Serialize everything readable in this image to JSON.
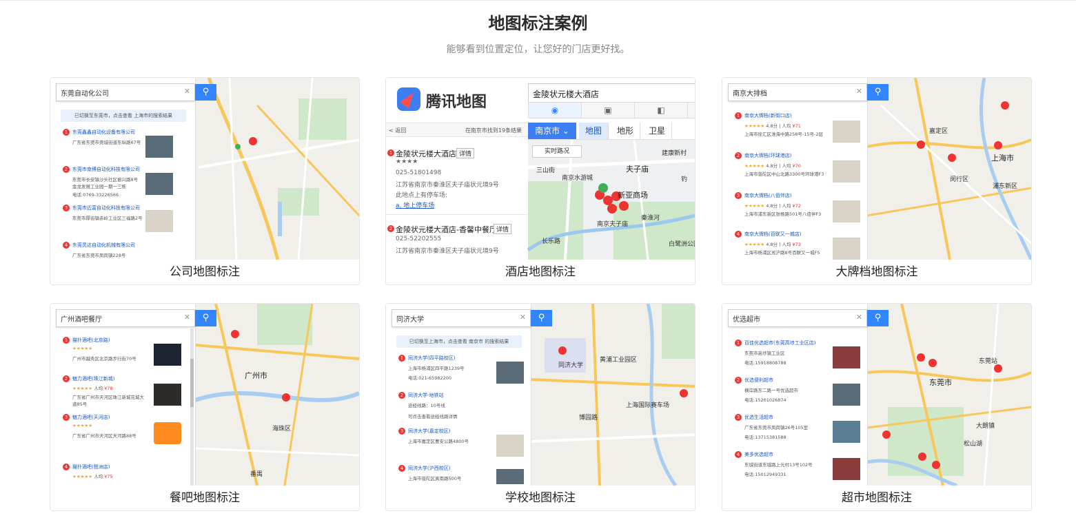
{
  "section": {
    "title": "地图标注案例",
    "subtitle": "能够看到位置定位，让您好的门店更好找。"
  },
  "cards": [
    {
      "caption": "公司地图标注",
      "search": "东莞自动化公司",
      "notice": "已切换至东莞市，点击查看 上海市的搜索结果",
      "results": [
        {
          "n": "1",
          "title": "东莞鑫鑫自动化设备有限公司",
          "line": "广东省东莞市莞城街道东纵路67号"
        },
        {
          "n": "2",
          "title": "东莞市南博自动化科技有限公司",
          "line": "东莞市长安镇沙头社区振兴路8号金龙发展工业园一期一三栋",
          "line2": "电话:0769-33226566"
        },
        {
          "n": "3",
          "title": "东莞市迈富自动化科技有限公司",
          "line": "东莞市厚街镇赤岭工业区三福路2号"
        },
        {
          "n": "4",
          "title": "东莞灵达自动化机械有限公司",
          "line": "广东省东莞市凤岗镇228号"
        }
      ]
    },
    {
      "caption": "酒店地图标注",
      "logo": "腾讯地图",
      "query": "金陵状元楼大酒店",
      "back": "< 返回",
      "count": "在南京市找到19条结果",
      "city": "南京市 ⌄",
      "tabs": [
        "地图",
        "地形",
        "卫星"
      ],
      "realtime": "实时路况",
      "items": [
        {
          "n": "1",
          "name": "金陵状元楼大酒店",
          "detail": "详情",
          "stars": "★★★★",
          "phone": "025-51801498",
          "addr": "江苏省南京市秦淮区夫子庙状元境9号",
          "park": "此地点上有停车场:",
          "link": "a. 地上停车场"
        },
        {
          "n": "2",
          "name": "金陵状元楼大酒店-香馨中餐厅",
          "detail": "详情",
          "phone": "025-52202555",
          "addr": "江苏省南京市秦淮区夫子庙状元境9号"
        }
      ],
      "map_labels": [
        "建康新村",
        "三山街",
        "夫子庙",
        "南京水游城",
        "新亚商场",
        "南京夫子庙",
        "秦淮河",
        "白鹭洲公园",
        "长乐路",
        "钓"
      ]
    },
    {
      "caption": "大牌档地图标注",
      "search": "南京大排档",
      "results": [
        {
          "n": "1",
          "title": "南京大牌档(新街口店)",
          "stars": "★★★★★",
          "rating": "4.8分",
          "price": "¥71",
          "line": "上海市徐汇区淮海中路258号-15号-2层"
        },
        {
          "n": "2",
          "title": "南京大牌档(环球港店)",
          "stars": "★★★★★",
          "rating": "4.8分",
          "price": "¥70",
          "line": "上海市普陀区中山北路3300号环球港F3"
        },
        {
          "n": "3",
          "title": "南京大牌档(八佰伴店)",
          "stars": "★★★★★",
          "rating": "4.8分",
          "price": "¥72",
          "line": "上海市浦东新区张杨路501号八佰伴F3"
        },
        {
          "n": "4",
          "title": "南京大牌档(百联又一城店)",
          "stars": "★★★★★",
          "rating": "4.8分",
          "price": "¥73",
          "line": "上海市杨浦区淞沪路8号百联又一城F5"
        }
      ],
      "map_labels": [
        "上海市",
        "嘉定区",
        "闵行区",
        "浦东新区"
      ]
    },
    {
      "caption": "餐吧地图标注",
      "search": "广州酒吧餐厅",
      "results": [
        {
          "n": "1",
          "title": "猫扑酒吧(北京路)",
          "stars": "★★★★★",
          "line": "广州市越秀区北京路步行街70号"
        },
        {
          "n": "2",
          "title": "魅力酒吧(珠江新城)",
          "stars": "★★★★★",
          "price": "¥78",
          "line": "广东省广州市天河区珠江新城花城大道85号"
        },
        {
          "n": "3",
          "title": "魅力酒吧(天河店)",
          "stars": "★★★★★",
          "line": "广东省广州市天河区天河路88号"
        },
        {
          "n": "4",
          "title": "猫扑酒吧(琶洲店)",
          "stars": "★★★★★",
          "price": "¥75",
          "line": "广东省广州市海珠区阅江西路"
        }
      ],
      "map_labels": [
        "广州市",
        "海珠区",
        "番禺"
      ]
    },
    {
      "caption": "学校地图标注",
      "search": "同济大学",
      "notice": "已切换至上海市，点击查看 南京市 的搜索结果",
      "results": [
        {
          "n": "1",
          "title": "同济大学(四平路校区)",
          "line": "上海市杨浦区四平路1239号",
          "line2": "电话:021-65982200"
        },
        {
          "n": "2",
          "title": "同济大学-地铁站",
          "line": "途经线路：10号线",
          "line2": "可点击查看途经线路详情"
        },
        {
          "n": "3",
          "title": "同济大学(嘉定校区)",
          "line": "上海市嘉定区曹安公路4800号"
        },
        {
          "n": "4",
          "title": "同济大学(沪西校区)",
          "line": "上海市普陀区真南路500号"
        }
      ],
      "map_labels": [
        "同济大学",
        "黄浦工业园区",
        "上海国际赛车场",
        "博园路"
      ]
    },
    {
      "caption": "超市地图标注",
      "search": "优选超市",
      "results": [
        {
          "n": "1",
          "title": "百佳优选超市(东莞高埗工业区店)",
          "line": "东莞市高埗镇工业区",
          "line2": "电话:15918808788"
        },
        {
          "n": "2",
          "title": "优选便利超市",
          "line": "横岸路东二路一号优选超市",
          "line2": "电话:15201026874"
        },
        {
          "n": "3",
          "title": "优选生活超市",
          "line": "广东省东莞市凤岗镇26号105室",
          "line2": "电话:13715381588"
        },
        {
          "n": "4",
          "title": "美多优选超市",
          "line": "东城街道东城路上元村13号102号",
          "line2": "电话:15012949331"
        }
      ],
      "map_labels": [
        "东莞市",
        "松山湖",
        "东莞站",
        "大朗镇"
      ]
    }
  ]
}
